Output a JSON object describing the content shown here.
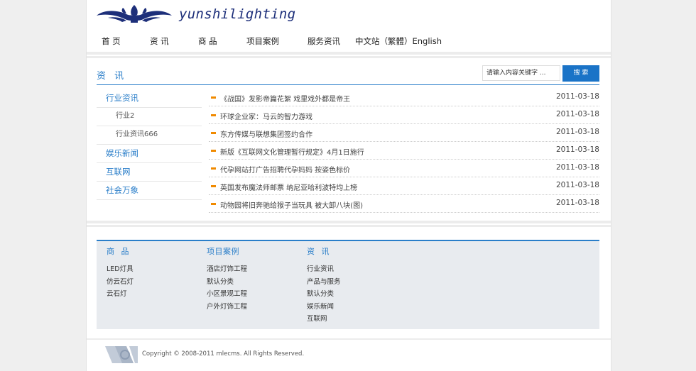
{
  "brand": {
    "name": "yunshilighting"
  },
  "nav": {
    "items": [
      "首 页",
      "资 讯",
      "商 品",
      "项目案例",
      "服务资讯",
      "中文站（繁體）English"
    ]
  },
  "section": {
    "title": "资 讯"
  },
  "search": {
    "placeholder": "请输入内容关键字 ...",
    "button": "搜 索"
  },
  "sidebar": {
    "items": [
      {
        "label": "行业资讯",
        "level": "main"
      },
      {
        "label": "行业2",
        "level": "sub"
      },
      {
        "label": "行业资讯666",
        "level": "sub"
      },
      {
        "label": "娱乐新闻",
        "level": "main"
      },
      {
        "label": "互联网",
        "level": "main"
      },
      {
        "label": "社会万象",
        "level": "main"
      }
    ]
  },
  "articles": [
    {
      "title": "《战国》发影帝篇花絮 戏里戏外都是帝王",
      "date": "2011-03-18"
    },
    {
      "title": "环球企业家：马云的智力游戏",
      "date": "2011-03-18"
    },
    {
      "title": "东方传媒与联想集团签约合作",
      "date": "2011-03-18"
    },
    {
      "title": "新版《互联网文化管理暂行规定》4月1日施行",
      "date": "2011-03-18"
    },
    {
      "title": "代孕网站打广告招聘代孕妈妈 按姿色标价",
      "date": "2011-03-18"
    },
    {
      "title": "英国发布魔法师邮票 纳尼亚哈利波特均上榜",
      "date": "2011-03-18"
    },
    {
      "title": "动物园将旧奔驰给猴子当玩具 被大卸八块(图)",
      "date": "2011-03-18"
    }
  ],
  "footer": {
    "columns": [
      {
        "title": "商 品",
        "links": [
          "LED灯具",
          "仿云石灯",
          "云石灯"
        ]
      },
      {
        "title": "项目案例",
        "links": [
          "酒店灯饰工程",
          "默认分类",
          "小区景观工程",
          "户外灯饰工程"
        ]
      },
      {
        "title": "资 讯",
        "links": [
          "行业资讯",
          "产品与服务",
          "默认分类",
          "娱乐新闻",
          "互联网"
        ]
      }
    ],
    "copyright": "Copyright © 2008-2011 mlecms. All Rights Reserved."
  },
  "colors": {
    "brand_navy": "#1d2f7a",
    "accent_blue": "#2a7ec9",
    "button_blue": "#1a73c7",
    "bullet_orange": "#f08a00",
    "footer_bg": "#e8ebef"
  }
}
